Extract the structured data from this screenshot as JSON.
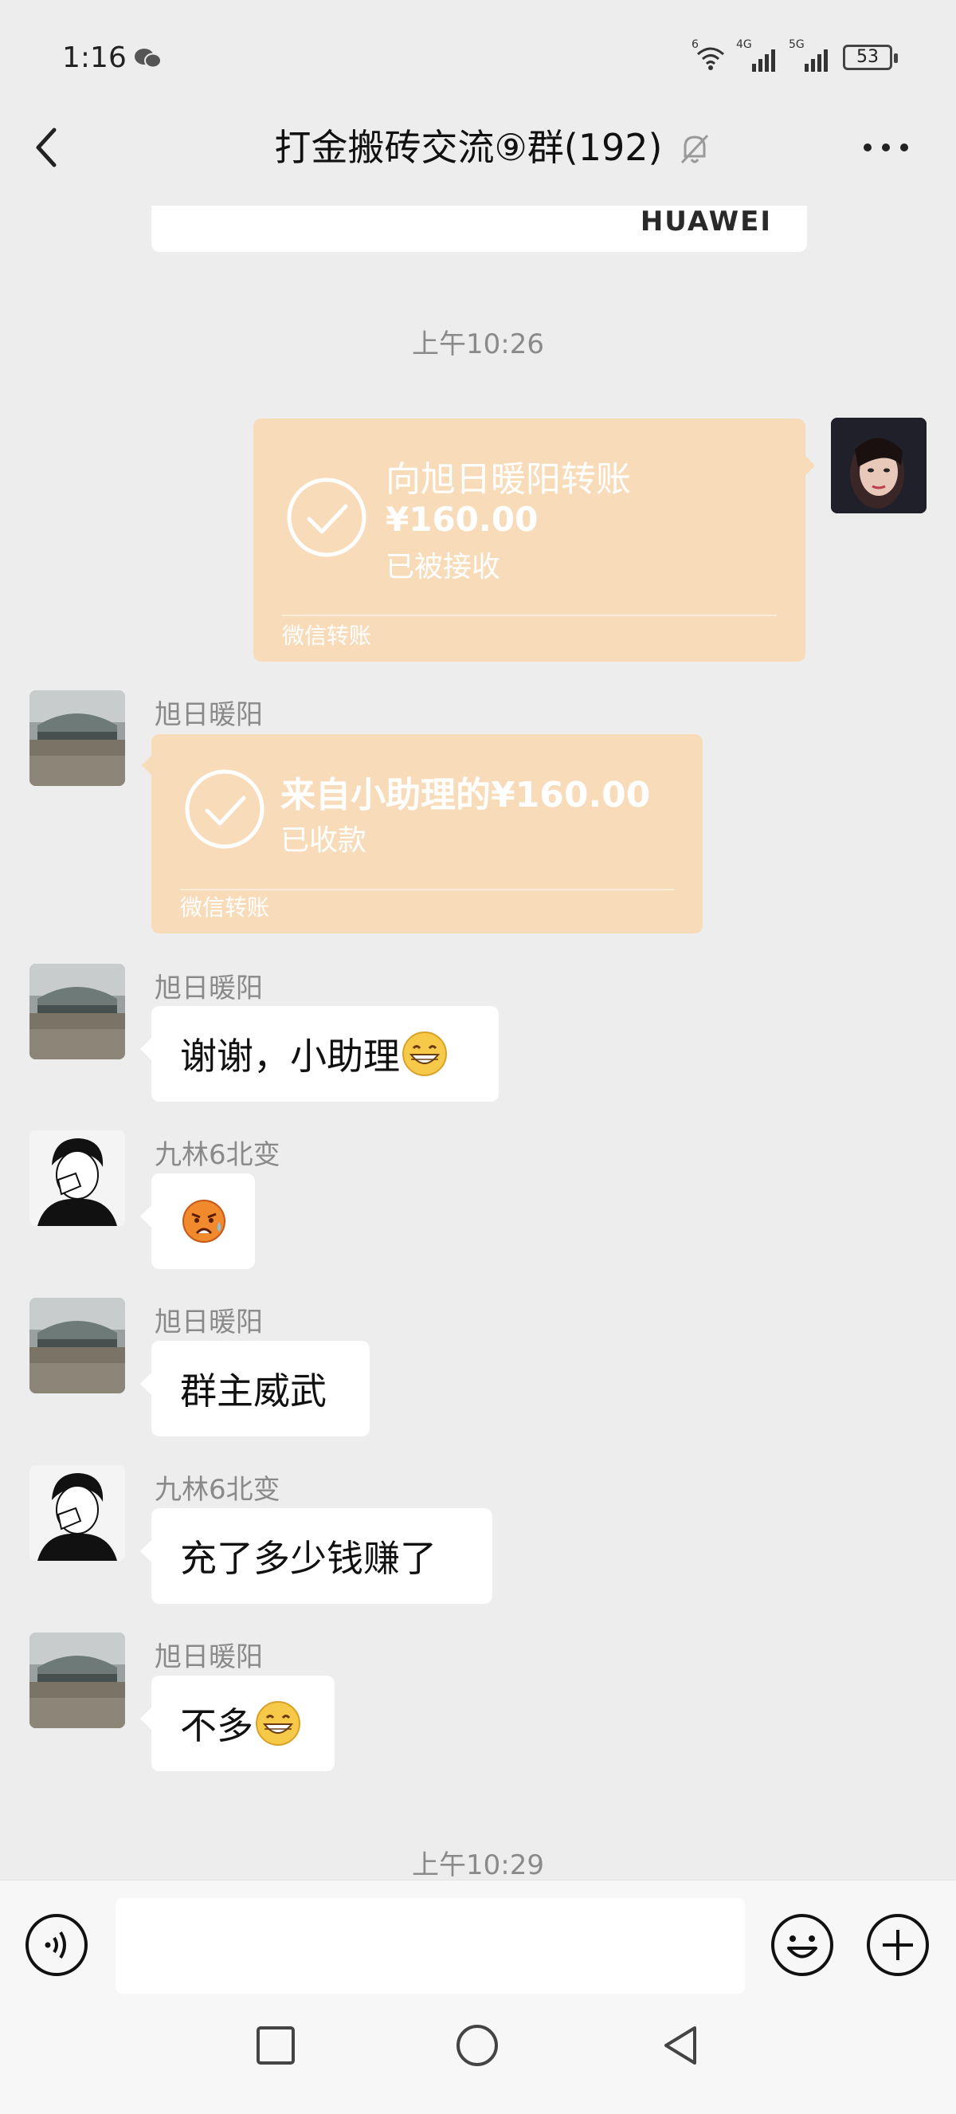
{
  "status_bar": {
    "time": "1:16",
    "battery": "53",
    "network_1": "6",
    "network_2": "4G",
    "network_3": "5G"
  },
  "header": {
    "title": "打金搬砖交流⑨群(192)"
  },
  "top_card": {
    "brand": "HUAWEI"
  },
  "timestamps": [
    "上午10:26",
    "上午10:29"
  ],
  "transfer_out": {
    "title": "向旭日暖阳转账",
    "amount": "¥160.00",
    "status": "已被接收",
    "footer": "微信转账"
  },
  "messages": [
    {
      "sender": "旭日暖阳",
      "type": "transfer",
      "title": "来自小助理的¥160.00",
      "status": "已收款",
      "footer": "微信转账"
    },
    {
      "sender": "旭日暖阳",
      "text": "谢谢，小助理",
      "emoji": "grin-emoji"
    },
    {
      "sender": "九林6北变",
      "text": "",
      "emoji": "angry-sweat-emoji"
    },
    {
      "sender": "旭日暖阳",
      "text": "群主威武"
    },
    {
      "sender": "九林6北变",
      "text": "充了多少钱赚了"
    },
    {
      "sender": "旭日暖阳",
      "text": "不多",
      "emoji": "grin-emoji"
    }
  ],
  "colors": {
    "transfer_bg": "#f8dcba",
    "chat_bg": "#ededed",
    "bubble": "#ffffff"
  }
}
